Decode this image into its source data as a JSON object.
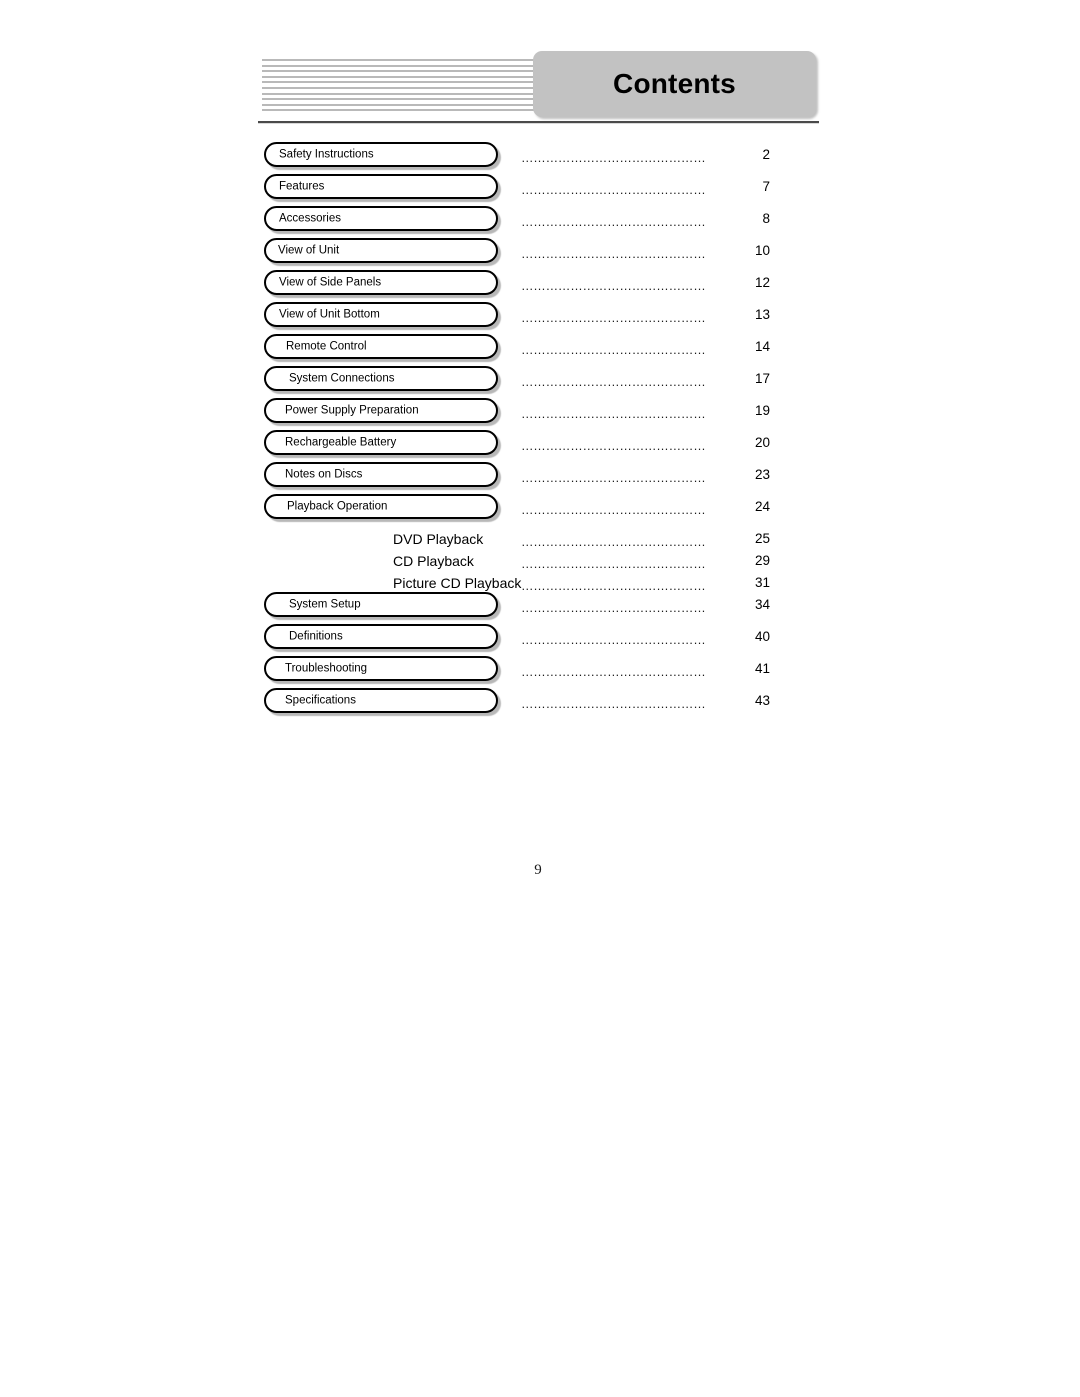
{
  "document": {
    "heading": "Contents",
    "folio": "9",
    "accent_gray": "#c2c2c2",
    "rule_color": "#4a4a4a",
    "stripe_color": "#b9b9b9",
    "stripe_count": 10,
    "leader_dots": "…………………………………………………"
  },
  "contents": [
    {
      "label": "Safety Instructions",
      "page": "2",
      "style": "pill",
      "indent": 9
    },
    {
      "label": "Features",
      "page": "7",
      "style": "pill",
      "indent": 9
    },
    {
      "label": "Accessories",
      "page": "8",
      "style": "pill",
      "indent": 9
    },
    {
      "label": "View of Unit",
      "page": "10",
      "style": "pill",
      "indent": 8
    },
    {
      "label": "View of Side Panels",
      "page": "12",
      "style": "pill",
      "indent": 9
    },
    {
      "label": "View of Unit Bottom",
      "page": "13",
      "style": "pill",
      "indent": 9
    },
    {
      "label": "Remote Control",
      "page": "14",
      "style": "pill",
      "indent": 16
    },
    {
      "label": "System Connections",
      "page": "17",
      "style": "pill",
      "indent": 19
    },
    {
      "label": "Power Supply Preparation",
      "page": "19",
      "style": "pill",
      "indent": 15
    },
    {
      "label": "Rechargeable Battery",
      "page": "20",
      "style": "pill",
      "indent": 15
    },
    {
      "label": "Notes on Discs",
      "page": "23",
      "style": "pill",
      "indent": 15
    },
    {
      "label": "Playback Operation",
      "page": "24",
      "style": "pill",
      "indent": 17
    },
    {
      "label": "DVD Playback",
      "page": "25",
      "style": "sub",
      "indent": 0
    },
    {
      "label": "CD Playback",
      "page": "29",
      "style": "sub",
      "indent": 0
    },
    {
      "label": "Picture CD Playback",
      "page": "31",
      "style": "sub",
      "indent": 0
    },
    {
      "label": "System Setup",
      "page": "34",
      "style": "pill",
      "indent": 19
    },
    {
      "label": "Definitions",
      "page": "40",
      "style": "pill",
      "indent": 19
    },
    {
      "label": "Troubleshooting",
      "page": "41",
      "style": "pill",
      "indent": 15
    },
    {
      "label": "Specifications",
      "page": "43",
      "style": "pill",
      "indent": 15
    }
  ]
}
